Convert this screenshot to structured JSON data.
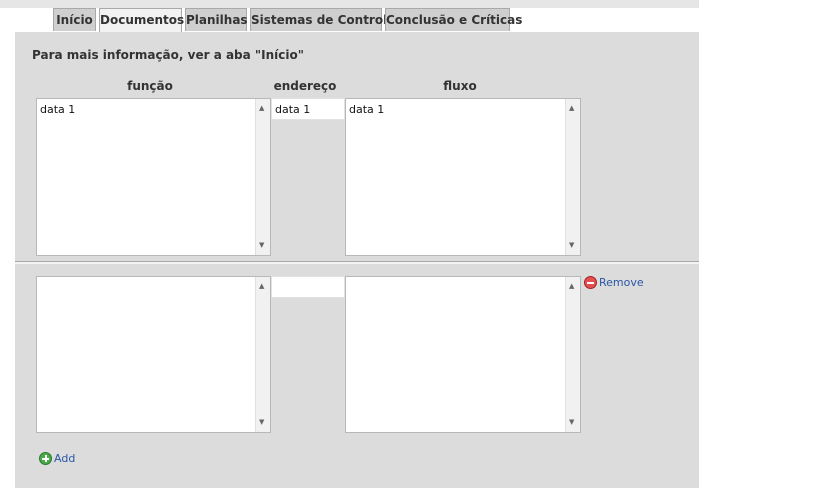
{
  "tabs": [
    {
      "label": "Início",
      "active": false
    },
    {
      "label": "Documentos",
      "active": true
    },
    {
      "label": "Planilhas",
      "active": false
    },
    {
      "label": "Sistemas de Controle",
      "active": false
    },
    {
      "label": "Conclusão e Críticas",
      "active": false
    }
  ],
  "info_text": "Para mais informação, ver a aba \"Início\"",
  "columns": {
    "funcao": "função",
    "endereco": "endereço",
    "fluxo": "fluxo"
  },
  "rows": [
    {
      "funcao": "data 1",
      "endereco": "data 1",
      "fluxo": "data 1"
    },
    {
      "funcao": "",
      "endereco": "",
      "fluxo": ""
    }
  ],
  "actions": {
    "remove_label": "Remove",
    "add_label": "Add"
  },
  "colors": {
    "panel": "#dcdcdc",
    "tab": "#cfcfcf",
    "link": "#2a56a6",
    "remove": "#e05050",
    "add": "#4aa84a"
  }
}
